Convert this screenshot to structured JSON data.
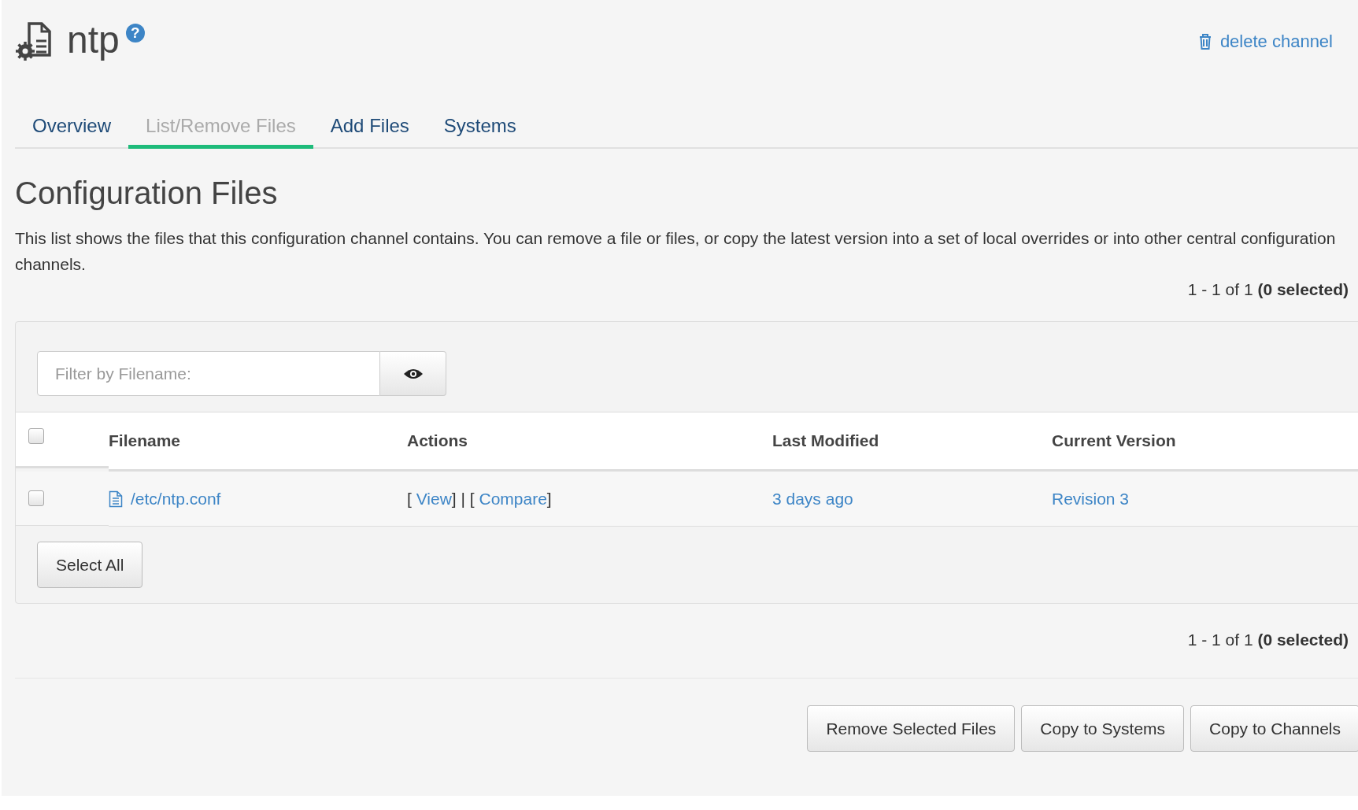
{
  "header": {
    "title": "ntp",
    "help": "?",
    "delete_link": "delete channel"
  },
  "tabs": [
    {
      "label": "Overview",
      "selected": false
    },
    {
      "label": "List/Remove Files",
      "selected": true
    },
    {
      "label": "Add Files",
      "selected": false
    },
    {
      "label": "Systems",
      "selected": false
    }
  ],
  "section": {
    "title": "Configuration Files",
    "description": "This list shows the files that this configuration channel contains. You can remove a file or files, or copy the latest version into a set of local overrides or into other central configuration channels."
  },
  "counter_top": {
    "range": "1 - 1 of 1",
    "selected": "(0 selected)"
  },
  "filter": {
    "placeholder": "Filter by Filename:"
  },
  "table": {
    "select_all_checked": false,
    "columns": [
      "Filename",
      "Actions",
      "Last Modified",
      "Current Version"
    ],
    "rows": [
      {
        "checked": false,
        "filename": "/etc/ntp.conf",
        "actions": [
          "[",
          "View",
          "] | [",
          "Compare",
          "]"
        ],
        "last_modified": "3 days ago",
        "current_version": "Revision 3"
      }
    ]
  },
  "select_all_button": "Select All",
  "counter_bottom": {
    "range": "1 - 1 of 1",
    "selected": "(0 selected)"
  },
  "buttons": [
    "Remove Selected Files",
    "Copy to Systems",
    "Copy to Channels"
  ]
}
